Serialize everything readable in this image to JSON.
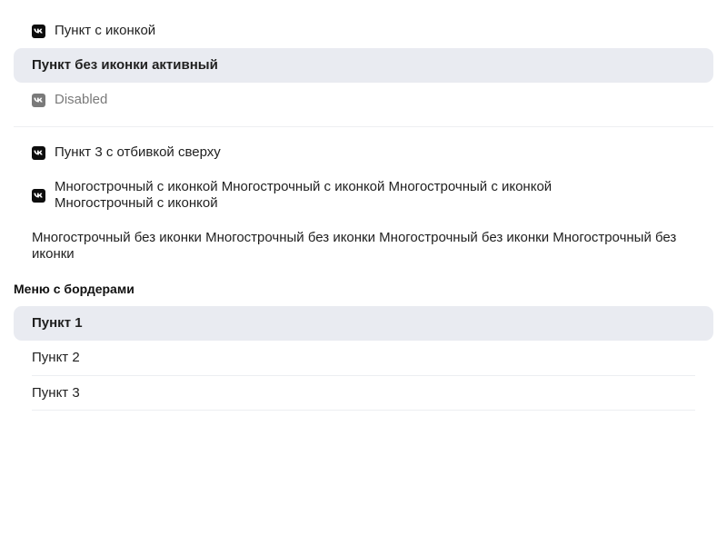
{
  "menu1": {
    "items": [
      {
        "label": "Пункт с иконкой",
        "icon": "vk-icon"
      },
      {
        "label": "Пункт без иконки активный"
      },
      {
        "label": "Disabled",
        "icon": "vk-icon"
      },
      {
        "label": "Пункт 3 с отбивкой сверху",
        "icon": "vk-icon"
      },
      {
        "label": "Многострочный с иконкой Многострочный с иконкой Многострочный с иконкой Многострочный с иконкой",
        "icon": "vk-icon"
      },
      {
        "label": "Многострочный без иконки Многострочный без иконки Многострочный без иконки Многострочный без иконки"
      }
    ]
  },
  "menu2": {
    "title": "Меню с бордерами",
    "items": [
      {
        "label": "Пункт 1"
      },
      {
        "label": "Пункт 2"
      },
      {
        "label": "Пункт 3"
      }
    ]
  },
  "colors": {
    "active_bg": "#e9ebf1",
    "icon_bg": "#0d0d0d",
    "disabled_text": "#7a7a7a"
  }
}
